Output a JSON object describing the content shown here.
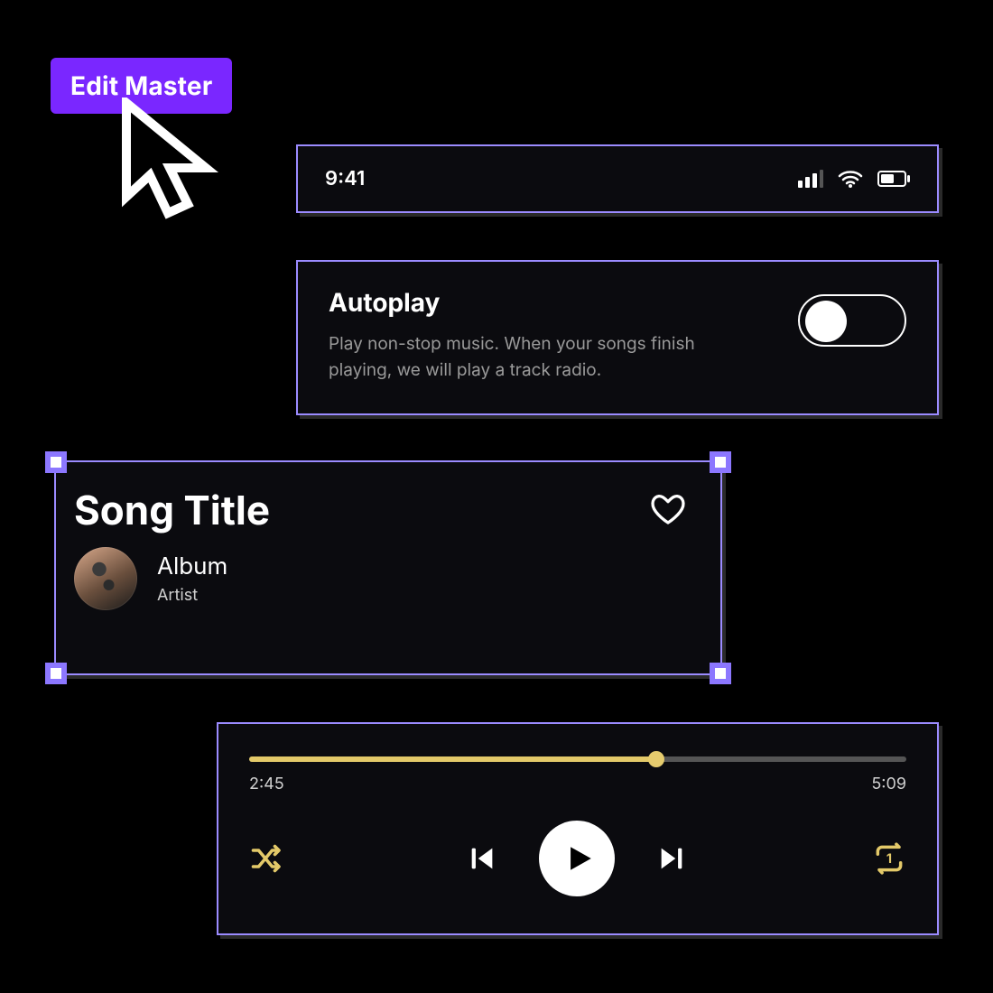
{
  "edit_master": {
    "label": "Edit Master"
  },
  "status_bar": {
    "time": "9:41"
  },
  "autoplay": {
    "title": "Autoplay",
    "description": "Play non-stop music. When your songs finish playing, we will play a track radio.",
    "enabled": false
  },
  "song_card": {
    "title": "Song Title",
    "album": "Album",
    "artist": "Artist",
    "favorited": false
  },
  "player": {
    "elapsed": "2:45",
    "total": "5:09",
    "progress_percent": 62,
    "shuffle": true,
    "repeat_mode": "one",
    "playing": false
  },
  "colors": {
    "accent_purple": "#7a27ff",
    "selection_outline": "#9b8bff",
    "progress_gold": "#e3c969"
  }
}
